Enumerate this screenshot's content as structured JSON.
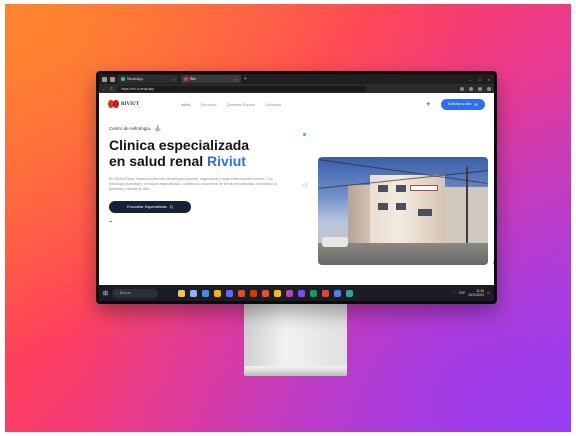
{
  "browser": {
    "tabs": [
      {
        "label": "WhatsApp",
        "close": "×"
      },
      {
        "label": "Rivi",
        "close": "×"
      }
    ],
    "new_tab": "+",
    "window_controls": [
      "–",
      "□",
      "×"
    ],
    "nav_buttons": [
      "←",
      "C"
    ],
    "url": "https://rivi.it.renal.app"
  },
  "site": {
    "logo_text": "RIVIUT",
    "menu": [
      "Inicio",
      "Servicios",
      "Quienes Somos",
      "Contacto"
    ],
    "theme_icon": "☀",
    "cta_label": "Solicita tu cita",
    "cta_icon": "☏",
    "eyebrow": "Centro de nefrología.",
    "eyebrow_icon": "⛪",
    "title_line1": "Clinica especializada",
    "title_line2": "en salud renal ",
    "title_accent": "Riviut",
    "description": "En Clínica Riviut, ofrecemos atención integral para prevenir, diagnosticar y tratar enfermedades renales. Con tecnología avanzada y un equipo especializado, cuidamos tu salud renal de forma personalizada, priorizando tu bienestar y calidad de vida.",
    "primary_button": "Encontrar Especialistas",
    "primary_button_icon": "Q"
  },
  "taskbar": {
    "windows_icon": "⊞",
    "search_placeholder": "Buscar",
    "search_icon": "⌕",
    "tray_text": "ESP",
    "time": "11:36",
    "date": "26/11/2024"
  },
  "colors": {
    "accent": "#2a6ff3",
    "dark_button": "#1a2033",
    "logo_red": "#e0301f",
    "deco_teal": "#27c6a2"
  }
}
